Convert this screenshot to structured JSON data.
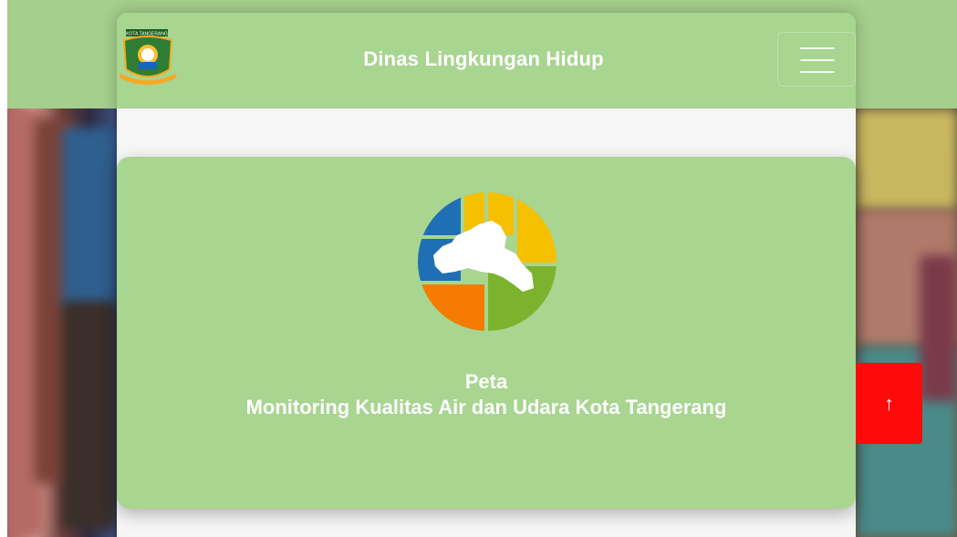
{
  "navbar": {
    "brand": "Dinas Lingkungan Hidup",
    "logo_text": "KOTA TANGERANG",
    "logo_icon": "kota-tangerang-seal",
    "menu_icon": "hamburger-icon"
  },
  "hero": {
    "logo_icon": "water-air-monitoring-map-logo",
    "title_line1": "Peta",
    "title_line2": "Monitoring Kualitas Air dan Udara Kota Tangerang"
  },
  "back_to_top": {
    "icon": "arrow-up-icon",
    "glyph": "↑"
  },
  "colors": {
    "header_green": "#a8d590",
    "hero_green": "#a8d590",
    "back_to_top_red": "#ff0a0a",
    "text_white": "#ffffff"
  }
}
